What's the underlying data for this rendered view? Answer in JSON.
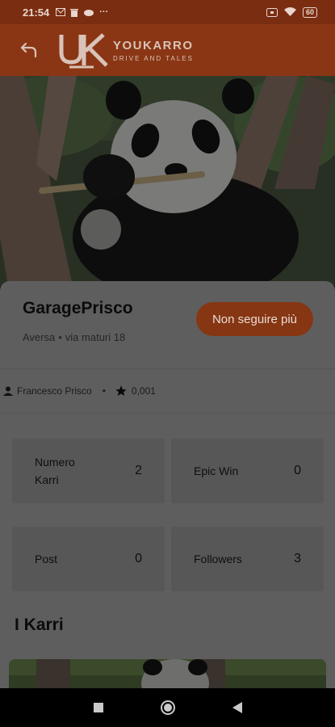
{
  "status": {
    "time": "21:54",
    "ellipsis": "···",
    "battery": "60"
  },
  "brand": {
    "title": "YOUKARRO",
    "tagline": "DRIVE AND TALES"
  },
  "shop": {
    "name": "GaragePrisco",
    "city": "Aversa",
    "separator": "•",
    "street": "via maturi 18"
  },
  "follow_button": "Non seguire più",
  "owner": {
    "name": "Francesco  Prisco",
    "separator": "•",
    "rating": "0,001"
  },
  "stats": [
    {
      "label": "Numero Karri",
      "value": "2"
    },
    {
      "label": "Epic Win",
      "value": "0"
    },
    {
      "label": "Post",
      "value": "0"
    },
    {
      "label": "Followers",
      "value": "3"
    }
  ],
  "section": {
    "title": "I Karri"
  },
  "colors": {
    "accent": "#8a3614",
    "button": "#863612"
  }
}
